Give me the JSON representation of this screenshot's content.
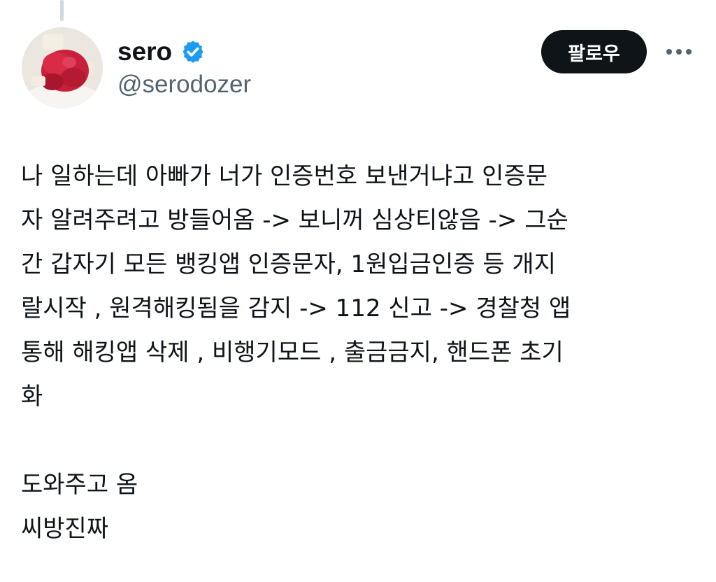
{
  "author": {
    "display_name": "sero",
    "handle": "@serodozer",
    "verified": true,
    "avatar_icon": "avatar-photo-red-dessert"
  },
  "actions": {
    "follow_label": "팔로우",
    "more_icon": "more-horizontal-icon"
  },
  "tweet": {
    "lines": [
      "나 일하는데 아빠가 너가 인증번호 보낸거냐고 인증문",
      "자 알려주려고 방들어옴 -> 보니꺼 심상티않음 -> 그순",
      "간 갑자기 모든 뱅킹앱 인증문자, 1원입금인증 등 개지",
      "랄시작 , 원격해킹됨을 감지 -> 112 신고 -> 경찰청 앱",
      "통해 해킹앱 삭제 , 비행기모드 , 출금금지, 핸드폰 초기",
      "화",
      "",
      "도와주고 옴",
      "씨방진짜"
    ]
  },
  "colors": {
    "text": "#0f1419",
    "secondary_text": "#536471",
    "verified_badge": "#1d9bf0",
    "follow_button_bg": "#0f1419",
    "thread_line": "#cfd9de"
  }
}
